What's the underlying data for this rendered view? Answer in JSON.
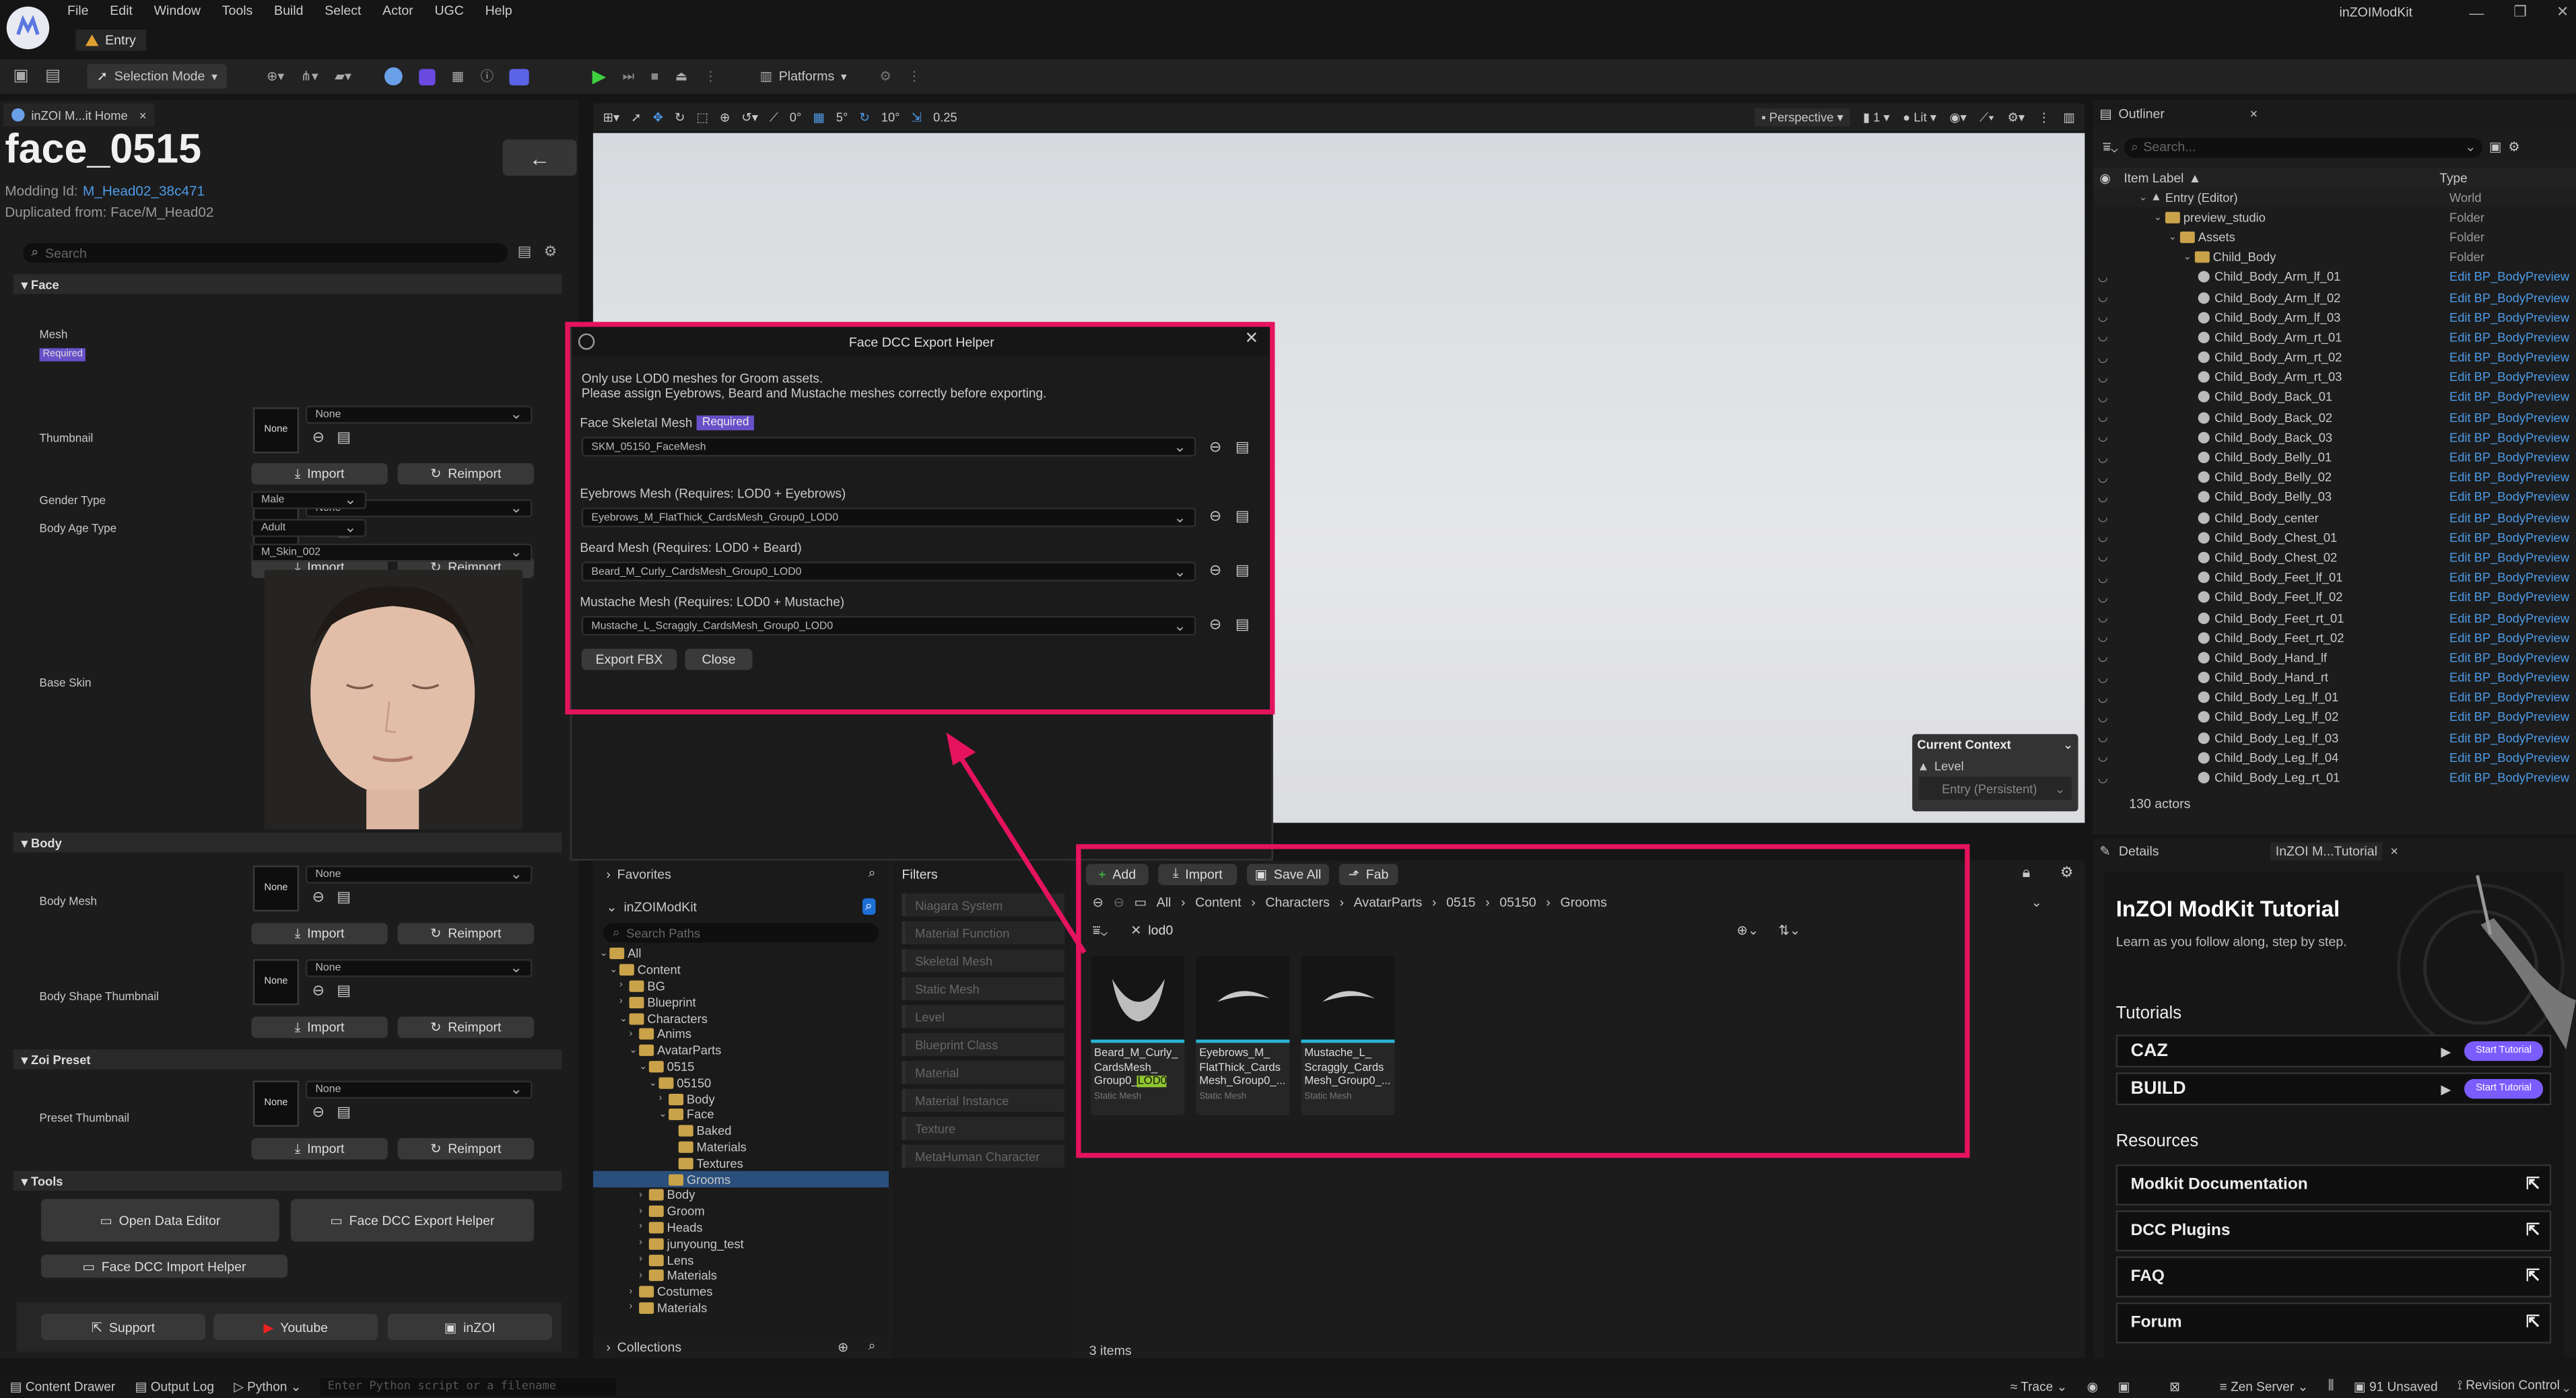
{
  "menubar": {
    "items": [
      "File",
      "Edit",
      "Window",
      "Tools",
      "Build",
      "Select",
      "Actor",
      "UGC",
      "Help"
    ],
    "project": "inZOIModKit",
    "tab": "Entry"
  },
  "toolbar": {
    "selection_mode": "Selection Mode",
    "platforms": "Platforms"
  },
  "left_panel": {
    "tab": "inZOI M...it Home",
    "title": "face_0515",
    "modding_id_label": "Modding Id:",
    "modding_id": "M_Head02_38c471",
    "duplicated_from": "Duplicated from: Face/M_Head02",
    "search_placeholder": "Search",
    "face_section": "Face",
    "mesh_label": "Mesh",
    "required": "Required",
    "none": "None",
    "import": "Import",
    "reimport": "Reimport",
    "thumbnail_label": "Thumbnail",
    "gender_label": "Gender Type",
    "gender_value": "Male",
    "body_age_label": "Body Age Type",
    "body_age_value": "Adult",
    "skin_value": "M_Skin_002",
    "base_skin_label": "Base Skin",
    "body_section": "Body",
    "body_mesh_label": "Body Mesh",
    "body_shape_label": "Body Shape Thumbnail",
    "zoi_section": "Zoi Preset",
    "preset_thumb_label": "Preset Thumbnail",
    "tools_section": "Tools",
    "open_data_editor": "Open Data Editor",
    "face_dcc_export": "Face DCC Export Helper",
    "face_dcc_import": "Face DCC Import Helper",
    "support": "Support",
    "youtube": "Youtube",
    "inzoi": "inZOI"
  },
  "viewport_bar": {
    "snap_angle": "0°",
    "snap_move": "5°",
    "snap_rot": "10°",
    "scale": "0.25",
    "perspective": "Perspective",
    "cam": "1",
    "lit": "Lit"
  },
  "dialog": {
    "title": "Face DCC Export Helper",
    "note1": "Only use LOD0 meshes for Groom assets.",
    "note2": "Please assign Eyebrows, Beard and Mustache meshes correctly before exporting.",
    "face_label": "Face Skeletal Mesh",
    "required": "Required",
    "face_value": "SKM_05150_FaceMesh",
    "eyebrows_label": "Eyebrows Mesh (Requires: LOD0 + Eyebrows)",
    "eyebrows_value": "Eyebrows_M_FlatThick_CardsMesh_Group0_LOD0",
    "beard_label": "Beard Mesh (Requires: LOD0 + Beard)",
    "beard_value": "Beard_M_Curly_CardsMesh_Group0_LOD0",
    "mustache_label": "Mustache Mesh (Requires: LOD0 + Mustache)",
    "mustache_value": "Mustache_L_Scraggly_CardsMesh_Group0_LOD0",
    "export_btn": "Export FBX",
    "close_btn": "Close"
  },
  "current_context": {
    "title": "Current Context",
    "level": "Level",
    "entry": "Entry (Persistent)"
  },
  "content_browser": {
    "favorites": "Favorites",
    "modkit": "inZOIModKit",
    "search_paths": "Search Paths",
    "collections": "Collections",
    "tree": [
      {
        "d": 0,
        "t": "All"
      },
      {
        "d": 1,
        "t": "Content"
      },
      {
        "d": 2,
        "t": "BG"
      },
      {
        "d": 2,
        "t": "Blueprint"
      },
      {
        "d": 2,
        "t": "Characters"
      },
      {
        "d": 3,
        "t": "Anims"
      },
      {
        "d": 3,
        "t": "AvatarParts"
      },
      {
        "d": 4,
        "t": "0515"
      },
      {
        "d": 5,
        "t": "05150"
      },
      {
        "d": 6,
        "t": "Body"
      },
      {
        "d": 6,
        "t": "Face"
      },
      {
        "d": 7,
        "t": "Baked"
      },
      {
        "d": 7,
        "t": "Materials"
      },
      {
        "d": 7,
        "t": "Textures"
      },
      {
        "d": 6,
        "t": "Grooms"
      },
      {
        "d": 4,
        "t": "Body"
      },
      {
        "d": 4,
        "t": "Groom"
      },
      {
        "d": 4,
        "t": "Heads"
      },
      {
        "d": 4,
        "t": "junyoung_test"
      },
      {
        "d": 4,
        "t": "Lens"
      },
      {
        "d": 4,
        "t": "Materials"
      },
      {
        "d": 3,
        "t": "Costumes"
      },
      {
        "d": 3,
        "t": "Materials"
      }
    ],
    "filters_title": "Filters",
    "filters": [
      "Niagara System",
      "Material Function",
      "Skeletal Mesh",
      "Static Mesh",
      "Level",
      "Blueprint Class",
      "Material",
      "Material Instance",
      "Texture",
      "MetaHuman Character"
    ],
    "add": "Add",
    "import": "Import",
    "save_all": "Save All",
    "fab": "Fab",
    "breadcrumb": [
      "All",
      "Content",
      "Characters",
      "AvatarParts",
      "0515",
      "05150",
      "Grooms"
    ],
    "search_value": "lod0",
    "assets": [
      {
        "name1": "Beard_M_Curly_",
        "name2": "CardsMesh_",
        "name3": "Group0_",
        "hl": "LOD0",
        "type": "Static Mesh"
      },
      {
        "name1": "Eyebrows_M_",
        "name2": "FlatThick_Cards",
        "name3": "Mesh_Group0_...",
        "hl": "",
        "type": "Static Mesh"
      },
      {
        "name1": "Mustache_L_",
        "name2": "Scraggly_Cards",
        "name3": "Mesh_Group0_...",
        "hl": "",
        "type": "Static Mesh"
      }
    ],
    "items_count": "3 items"
  },
  "outliner": {
    "tab": "Outliner",
    "search_placeholder": "Search...",
    "col_label": "Item Label",
    "col_type": "Type",
    "rows": [
      {
        "d": 0,
        "n": "Entry (Editor)",
        "t": "World",
        "k": "world"
      },
      {
        "d": 1,
        "n": "preview_studio",
        "t": "Folder",
        "k": "folder"
      },
      {
        "d": 2,
        "n": "Assets",
        "t": "Folder",
        "k": "folder"
      },
      {
        "d": 3,
        "n": "Child_Body",
        "t": "Folder",
        "k": "folder"
      },
      {
        "d": 4,
        "n": "Child_Body_Arm_lf_01",
        "t": "Edit BP_BodyPreview",
        "k": "a"
      },
      {
        "d": 4,
        "n": "Child_Body_Arm_lf_02",
        "t": "Edit BP_BodyPreview",
        "k": "a"
      },
      {
        "d": 4,
        "n": "Child_Body_Arm_lf_03",
        "t": "Edit BP_BodyPreview",
        "k": "a"
      },
      {
        "d": 4,
        "n": "Child_Body_Arm_rt_01",
        "t": "Edit BP_BodyPreview",
        "k": "a"
      },
      {
        "d": 4,
        "n": "Child_Body_Arm_rt_02",
        "t": "Edit BP_BodyPreview",
        "k": "a"
      },
      {
        "d": 4,
        "n": "Child_Body_Arm_rt_03",
        "t": "Edit BP_BodyPreview",
        "k": "a"
      },
      {
        "d": 4,
        "n": "Child_Body_Back_01",
        "t": "Edit BP_BodyPreview",
        "k": "a"
      },
      {
        "d": 4,
        "n": "Child_Body_Back_02",
        "t": "Edit BP_BodyPreview",
        "k": "a"
      },
      {
        "d": 4,
        "n": "Child_Body_Back_03",
        "t": "Edit BP_BodyPreview",
        "k": "a"
      },
      {
        "d": 4,
        "n": "Child_Body_Belly_01",
        "t": "Edit BP_BodyPreview",
        "k": "a"
      },
      {
        "d": 4,
        "n": "Child_Body_Belly_02",
        "t": "Edit BP_BodyPreview",
        "k": "a"
      },
      {
        "d": 4,
        "n": "Child_Body_Belly_03",
        "t": "Edit BP_BodyPreview",
        "k": "a"
      },
      {
        "d": 4,
        "n": "Child_Body_center",
        "t": "Edit BP_BodyPreview",
        "k": "a"
      },
      {
        "d": 4,
        "n": "Child_Body_Chest_01",
        "t": "Edit BP_BodyPreview",
        "k": "a"
      },
      {
        "d": 4,
        "n": "Child_Body_Chest_02",
        "t": "Edit BP_BodyPreview",
        "k": "a"
      },
      {
        "d": 4,
        "n": "Child_Body_Feet_lf_01",
        "t": "Edit BP_BodyPreview",
        "k": "a"
      },
      {
        "d": 4,
        "n": "Child_Body_Feet_lf_02",
        "t": "Edit BP_BodyPreview",
        "k": "a"
      },
      {
        "d": 4,
        "n": "Child_Body_Feet_rt_01",
        "t": "Edit BP_BodyPreview",
        "k": "a"
      },
      {
        "d": 4,
        "n": "Child_Body_Feet_rt_02",
        "t": "Edit BP_BodyPreview",
        "k": "a"
      },
      {
        "d": 4,
        "n": "Child_Body_Hand_lf",
        "t": "Edit BP_BodyPreview",
        "k": "a"
      },
      {
        "d": 4,
        "n": "Child_Body_Hand_rt",
        "t": "Edit BP_BodyPreview",
        "k": "a"
      },
      {
        "d": 4,
        "n": "Child_Body_Leg_lf_01",
        "t": "Edit BP_BodyPreview",
        "k": "a"
      },
      {
        "d": 4,
        "n": "Child_Body_Leg_lf_02",
        "t": "Edit BP_BodyPreview",
        "k": "a"
      },
      {
        "d": 4,
        "n": "Child_Body_Leg_lf_03",
        "t": "Edit BP_BodyPreview",
        "k": "a"
      },
      {
        "d": 4,
        "n": "Child_Body_Leg_lf_04",
        "t": "Edit BP_BodyPreview",
        "k": "a"
      },
      {
        "d": 4,
        "n": "Child_Body_Leg_rt_01",
        "t": "Edit BP_BodyPreview",
        "k": "a"
      }
    ],
    "actors": "130 actors"
  },
  "tutorial": {
    "details_tab": "Details",
    "tab": "InZOI M...Tutorial",
    "title": "InZOI ModKit Tutorial",
    "subtitle": "Learn as you follow along, step by step.",
    "tutorials_h": "Tutorials",
    "caz": "CAZ",
    "build": "BUILD",
    "start": "Start Tutorial",
    "resources_h": "Resources",
    "resources": [
      "Modkit Documentation",
      "DCC Plugins",
      "FAQ",
      "Forum"
    ]
  },
  "statusbar": {
    "content_drawer": "Content Drawer",
    "output_log": "Output Log",
    "python": "Python",
    "cmd_placeholder": "Enter Python script or a filename",
    "trace": "Trace",
    "zen": "Zen Server",
    "unsaved": "91 Unsaved",
    "revision": "Revision Control"
  },
  "colors": {
    "accent": "#e5135e",
    "blue": "#4d9be8",
    "purple": "#7b5cff"
  }
}
